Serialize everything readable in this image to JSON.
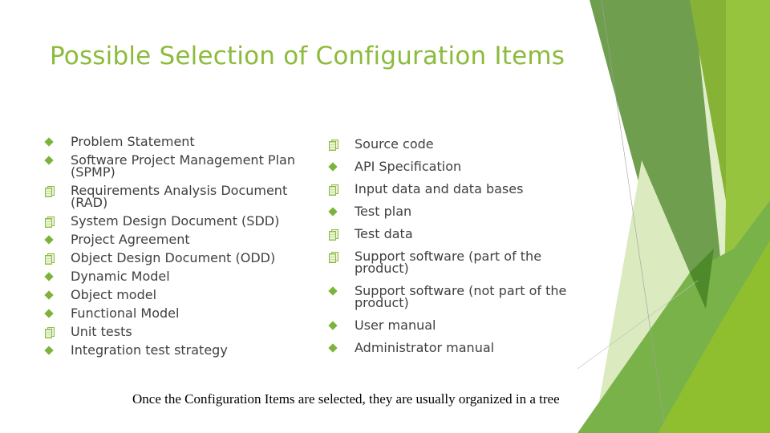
{
  "slide": {
    "title": "Possible Selection of Configuration Items",
    "left_items": [
      {
        "text": "Problem Statement",
        "bullet": "diamond"
      },
      {
        "text": "Software Project Management Plan (SPMP)",
        "bullet": "diamond"
      },
      {
        "text": "Requirements Analysis Document (RAD)",
        "bullet": "document"
      },
      {
        "text": "System Design Document (SDD)",
        "bullet": "document"
      },
      {
        "text": "Project Agreement",
        "bullet": "diamond"
      },
      {
        "text": "Object Design Document  (ODD)",
        "bullet": "document"
      },
      {
        "text": "Dynamic Model",
        "bullet": "diamond"
      },
      {
        "text": "Object model",
        "bullet": "diamond"
      },
      {
        "text": "Functional Model",
        "bullet": "diamond"
      },
      {
        "text": "Unit tests",
        "bullet": "document"
      },
      {
        "text": "Integration test strategy",
        "bullet": "diamond"
      }
    ],
    "right_items": [
      {
        "text": "Source code",
        "bullet": "document"
      },
      {
        "text": "API Specification",
        "bullet": "diamond"
      },
      {
        "text": "Input data and data bases",
        "bullet": "document"
      },
      {
        "text": "Test plan",
        "bullet": "diamond"
      },
      {
        "text": "Test data",
        "bullet": "document"
      },
      {
        "text": "Support software (part of the product)",
        "bullet": "document"
      },
      {
        "text": "Support software (not part of the product)",
        "bullet": "diamond"
      },
      {
        "text": "User manual",
        "bullet": "diamond"
      },
      {
        "text": "Administrator manual",
        "bullet": "diamond"
      }
    ],
    "footer_note": "Once the Configuration Items are selected, they are usually organized in a tree"
  },
  "colors": {
    "title": "#8cbb3c",
    "bullet": "#7cb33a",
    "text": "#404040"
  }
}
